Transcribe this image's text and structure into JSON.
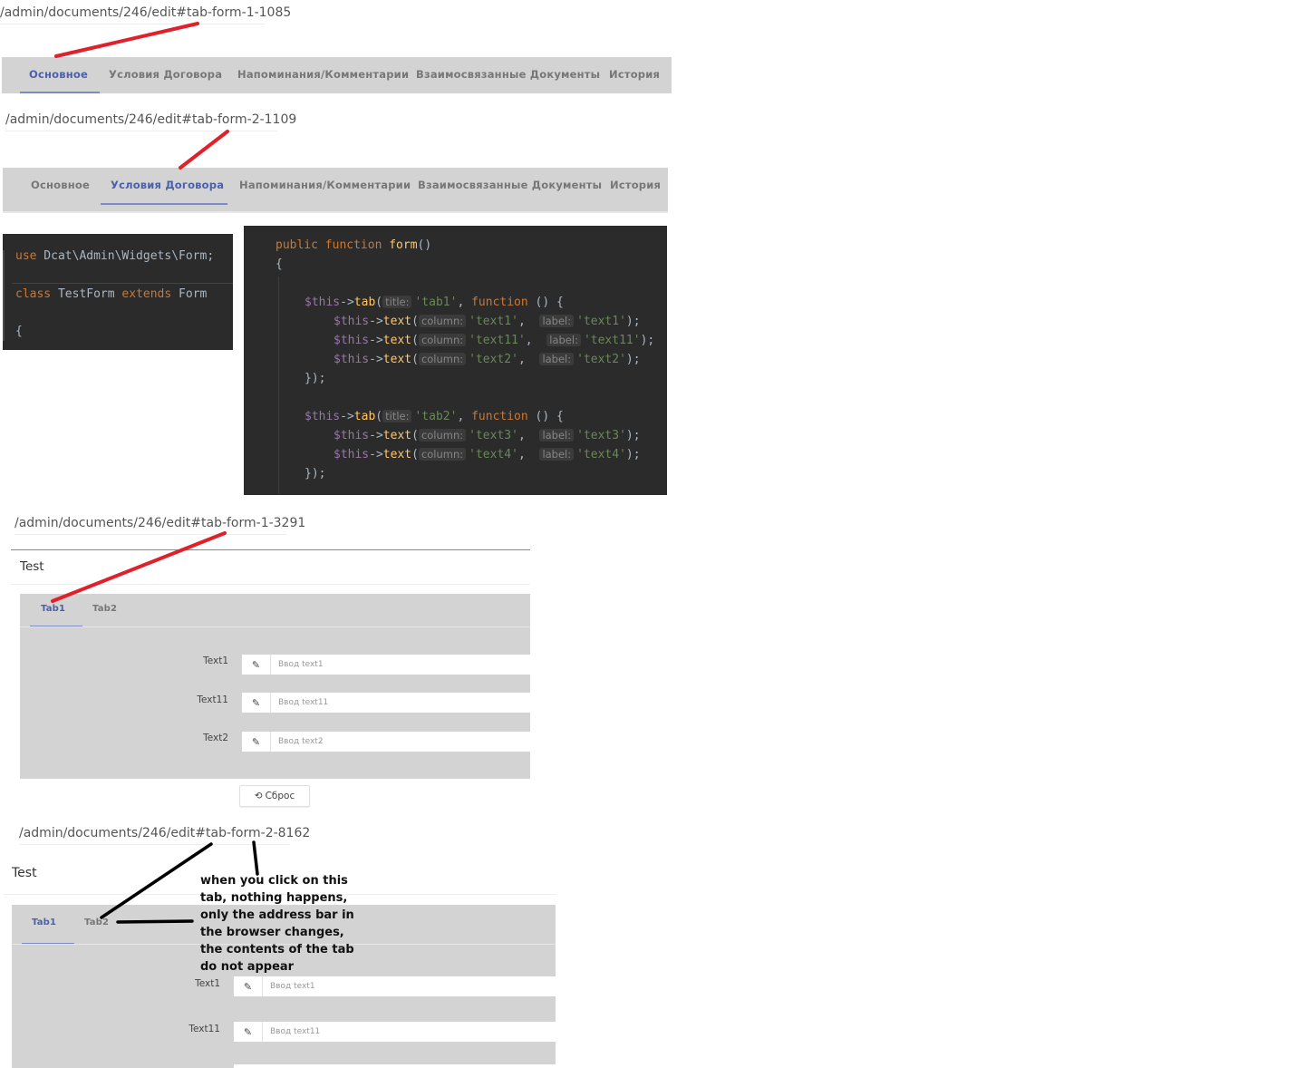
{
  "shot1": {
    "url": "/admin/documents/246/edit#tab-form-1-1085",
    "tabs": [
      "Основное",
      "Условия Договора",
      "Напоминания/Комментарии",
      "Взаимосвязанные Документы",
      "История"
    ]
  },
  "shot2": {
    "url": "/admin/documents/246/edit#tab-form-2-1109",
    "tabs": [
      "Основное",
      "Условия Договора",
      "Напоминания/Комментарии",
      "Взаимосвязанные Документы",
      "История"
    ]
  },
  "code_left": {
    "line1_kw": "use",
    "line1_rest": " Dcat\\Admin\\Widgets\\Form;",
    "line2_kw": "class",
    "line2_name": " TestForm ",
    "line2_kw2": "extends",
    "line2_rest": " Form",
    "line3": "{"
  },
  "code_right": {
    "sig_kw": "public function ",
    "sig_fn": "form",
    "sig_rest": "()",
    "open_brace": "{",
    "this": "$this",
    "arrow": "->",
    "tab_fn": "tab",
    "text_fn": "text",
    "hint_title": "title:",
    "hint_column": "column:",
    "hint_label": "label:",
    "function_kw": "function",
    "closure_parens": " () {",
    "close": "});",
    "tab1": "'tab1'",
    "tab2": "'tab2'",
    "fields_tab1": [
      {
        "column": "'text1'",
        "label": "'text1'"
      },
      {
        "column": "'text11'",
        "label": "'text11'"
      },
      {
        "column": "'text2'",
        "label": "'text2'"
      }
    ],
    "fields_tab2": [
      {
        "column": "'text3'",
        "label": "'text3'"
      },
      {
        "column": "'text4'",
        "label": "'text4'"
      }
    ]
  },
  "shot3": {
    "url": "/admin/documents/246/edit#tab-form-1-3291",
    "title": "Test",
    "tabs": [
      "Tab1",
      "Tab2"
    ],
    "fields": [
      {
        "label": "Text1",
        "placeholder": "Ввод text1"
      },
      {
        "label": "Text11",
        "placeholder": "Ввод text11"
      },
      {
        "label": "Text2",
        "placeholder": "Ввод text2"
      }
    ],
    "reset_label": "Сброс"
  },
  "shot4": {
    "url": "/admin/documents/246/edit#tab-form-2-8162",
    "title": "Test",
    "tabs": [
      "Tab1",
      "Tab2"
    ],
    "fields": [
      {
        "label": "Text1",
        "placeholder": "Ввод text1"
      },
      {
        "label": "Text11",
        "placeholder": "Ввод text11"
      }
    ]
  },
  "annotation": {
    "lines": [
      "when you click on this",
      "tab, nothing happens,",
      "only the address bar in",
      "the browser changes,",
      "the contents of the tab",
      "do not appear"
    ]
  },
  "colors": {
    "active_tab": "#4c60aa",
    "annotation_red": "#e0202a",
    "annotation_black": "#000000",
    "code_bg": "#2b2b2b"
  }
}
